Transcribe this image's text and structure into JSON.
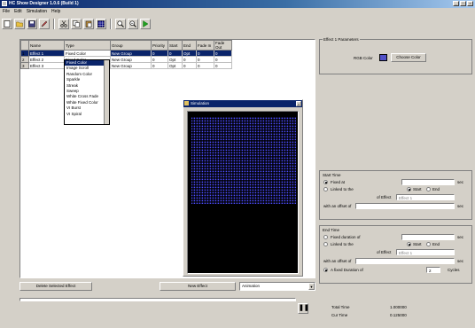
{
  "window": {
    "title": "HC Show Designer 1.0.6 (Build 1)"
  },
  "menu": [
    "File",
    "Edit",
    "Simulation",
    "Help"
  ],
  "toolbar": [
    "new-icon",
    "open-icon",
    "save-icon",
    "edit-icon",
    "cut-icon",
    "copy-icon",
    "paste-icon",
    "grid-icon",
    "zoom-in-icon",
    "zoom-out-icon",
    "play-icon"
  ],
  "grid": {
    "columns": [
      "Name",
      "Type",
      "Group",
      "Priority",
      "Start",
      "End",
      "Fade In",
      "Fade Out"
    ],
    "rows": [
      [
        "Effect 1",
        "Fixed Color",
        "New Group",
        "0",
        "0",
        "Opt",
        "0",
        "0"
      ],
      [
        "Effect 2",
        "Fixed Color",
        "New Group",
        "0",
        "Opt",
        "0",
        "0",
        "0"
      ],
      [
        "Effect 3",
        "Fixed Color",
        "New Group",
        "0",
        "Opt",
        "0",
        "0",
        "0"
      ]
    ],
    "row_headers": [
      "1",
      "2",
      "3"
    ]
  },
  "type_dropdown": [
    "Fixed Color",
    "Image Scroll",
    "Random Color",
    "Sparkle",
    "Streak",
    "Sweep",
    "White Cross Fade",
    "White Fixed Color",
    "VI Burst",
    "VI Spiral"
  ],
  "preview_window": {
    "title": "Simulation"
  },
  "bottom_bar": {
    "delete_label": "Delete Selected Effect",
    "new_effect_label": "New Effect",
    "group_select": "Animation"
  },
  "right": {
    "params_title": "Effect 1 Parameters",
    "rgb_label": "RGB Color",
    "rgb_color": "#5050c8",
    "choose_color": "Choose Color",
    "start": {
      "title": "Start Time",
      "fixed_at": "Fixed at",
      "linked": "Linked to the",
      "start_opt": "Start",
      "end_opt": "End",
      "of_effect": "of Effect",
      "effect_val": "Effect 1",
      "offset_label": "with an offset of",
      "unit": "sec"
    },
    "end": {
      "title": "End Time",
      "fixed_duration": "Fixed duration of",
      "linked": "Linked to the",
      "start_opt": "Start",
      "end_opt": "End",
      "of_effect": "of Effect",
      "effect_val": "Effect 1",
      "offset_label": "with an offset of",
      "fixed_duration2": "A fixed Duration of",
      "cycles_val": "2",
      "cycles": "Cycles",
      "unit": "sec"
    },
    "total_time_label": "Total Time",
    "total_time": "1.000000",
    "cur_time_label": "Cur Time",
    "cur_time": "0.125000"
  }
}
